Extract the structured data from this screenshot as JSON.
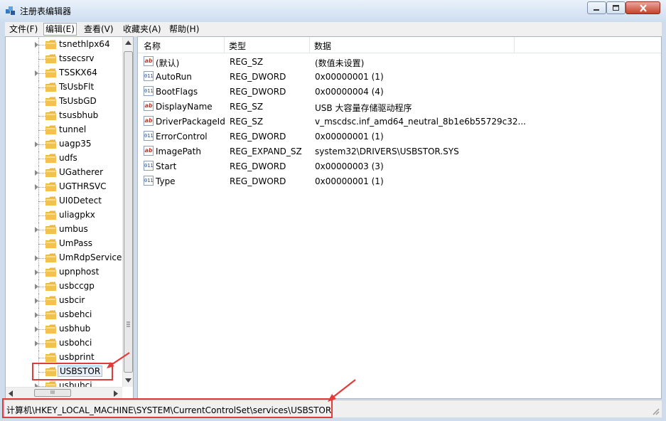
{
  "window": {
    "title": "注册表编辑器"
  },
  "menu": [
    {
      "label": "文件(F)"
    },
    {
      "label": "编辑(E)"
    },
    {
      "label": "查看(V)"
    },
    {
      "label": "收藏夹(A)"
    },
    {
      "label": "帮助(H)"
    }
  ],
  "tree": {
    "items": [
      {
        "label": "tsnethlpx64",
        "expandable": true
      },
      {
        "label": "tssecsrv",
        "expandable": false
      },
      {
        "label": "TSSKX64",
        "expandable": true
      },
      {
        "label": "TsUsbFlt",
        "expandable": false
      },
      {
        "label": "TsUsbGD",
        "expandable": false
      },
      {
        "label": "tsusbhub",
        "expandable": false
      },
      {
        "label": "tunnel",
        "expandable": false
      },
      {
        "label": "uagp35",
        "expandable": true
      },
      {
        "label": "udfs",
        "expandable": false
      },
      {
        "label": "UGatherer",
        "expandable": true
      },
      {
        "label": "UGTHRSVC",
        "expandable": true
      },
      {
        "label": "UI0Detect",
        "expandable": false
      },
      {
        "label": "uliagpkx",
        "expandable": false
      },
      {
        "label": "umbus",
        "expandable": true
      },
      {
        "label": "UmPass",
        "expandable": false
      },
      {
        "label": "UmRdpService",
        "expandable": true
      },
      {
        "label": "upnphost",
        "expandable": true
      },
      {
        "label": "usbccgp",
        "expandable": true
      },
      {
        "label": "usbcir",
        "expandable": true
      },
      {
        "label": "usbehci",
        "expandable": true
      },
      {
        "label": "usbhub",
        "expandable": true
      },
      {
        "label": "usbohci",
        "expandable": true
      },
      {
        "label": "usbprint",
        "expandable": false
      },
      {
        "label": "USBSTOR",
        "expandable": false,
        "selected": true
      },
      {
        "label": "usbuhci",
        "expandable": true
      }
    ]
  },
  "values": {
    "headers": {
      "name": "名称",
      "type": "类型",
      "data": "数据"
    },
    "rows": [
      {
        "icon": "string-value-icon",
        "name": "(默认)",
        "type": "REG_SZ",
        "data": "(数值未设置)"
      },
      {
        "icon": "binary-value-icon",
        "name": "AutoRun",
        "type": "REG_DWORD",
        "data": "0x00000001 (1)"
      },
      {
        "icon": "binary-value-icon",
        "name": "BootFlags",
        "type": "REG_DWORD",
        "data": "0x00000004 (4)"
      },
      {
        "icon": "string-value-icon",
        "name": "DisplayName",
        "type": "REG_SZ",
        "data": "USB 大容量存储驱动程序"
      },
      {
        "icon": "string-value-icon",
        "name": "DriverPackageId",
        "type": "REG_SZ",
        "data": "v_mscdsc.inf_amd64_neutral_8b1e6b55729c32..."
      },
      {
        "icon": "binary-value-icon",
        "name": "ErrorControl",
        "type": "REG_DWORD",
        "data": "0x00000001 (1)"
      },
      {
        "icon": "string-value-icon",
        "name": "ImagePath",
        "type": "REG_EXPAND_SZ",
        "data": "system32\\DRIVERS\\USBSTOR.SYS"
      },
      {
        "icon": "binary-value-icon",
        "name": "Start",
        "type": "REG_DWORD",
        "data": "0x00000003 (3)"
      },
      {
        "icon": "binary-value-icon",
        "name": "Type",
        "type": "REG_DWORD",
        "data": "0x00000001 (1)"
      }
    ]
  },
  "status": {
    "path": "计算机\\HKEY_LOCAL_MACHINE\\SYSTEM\\CurrentControlSet\\services\\USBSTOR"
  },
  "scroll_labels": {
    "hthumb": "III"
  },
  "colors": {
    "annotation": "#e23b3b",
    "selection": "#e5eef8",
    "folder": "#f2c24f"
  }
}
